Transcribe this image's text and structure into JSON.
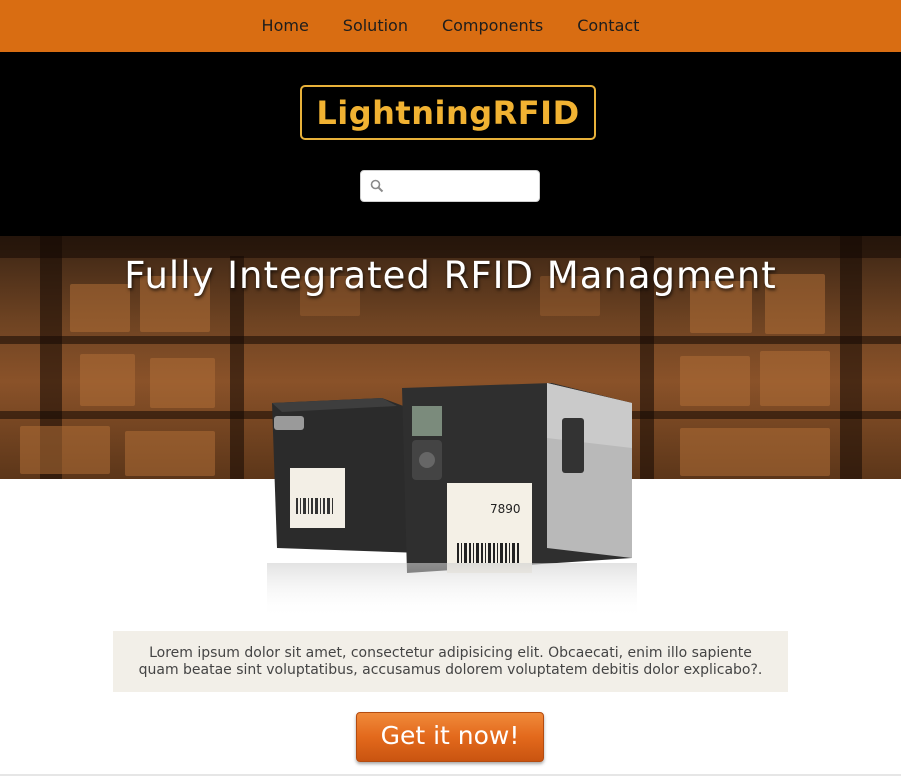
{
  "nav": {
    "items": [
      {
        "label": "Home"
      },
      {
        "label": "Solution"
      },
      {
        "label": "Components"
      },
      {
        "label": "Contact"
      }
    ]
  },
  "header": {
    "logo": "LightningRFID",
    "search": {
      "value": "",
      "placeholder": "",
      "icon": "search-icon"
    }
  },
  "hero": {
    "title": "Fully Integrated RFID Managment",
    "printer_label_code": "7890"
  },
  "content": {
    "description": "Lorem ipsum dolor sit amet, consectetur adipisicing elit. Obcaecati, enim illo sapiente quam beatae sint voluptatibus, accusamus dolorem voluptatem debitis dolor explicabo?.",
    "cta_label": "Get it now!"
  },
  "colors": {
    "nav_bg": "#d96d12",
    "header_bg": "#000000",
    "logo_accent": "#f1b232",
    "cta_bg": "#e3691c",
    "desc_bg": "#f2efe8"
  }
}
